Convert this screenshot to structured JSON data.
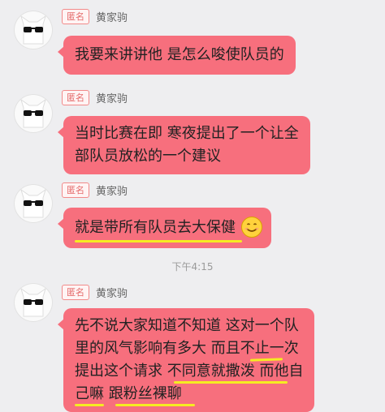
{
  "messages": [
    {
      "badge": "匿名",
      "sender": "黄家驹",
      "lines": [
        "我要来讲讲他 是怎么唆使队员的"
      ]
    },
    {
      "badge": "匿名",
      "sender": "黄家驹",
      "lines": [
        "当时比赛在即 寒夜提出了一个让全",
        "部队员放松的一个建议"
      ]
    },
    {
      "badge": "匿名",
      "sender": "黄家驹",
      "lines": [
        "就是带所有队员去大保健"
      ]
    },
    {
      "badge": "匿名",
      "sender": "黄家驹",
      "lines": [
        "先不说大家知道不知道 这对一个队",
        "里的风气影响有多大 而且不止一次",
        "提出这个请求 不同意就撒泼 而他自",
        "己嘛 跟粉丝裸聊"
      ]
    }
  ],
  "timestamp": "下午4:15",
  "colors": {
    "bubble": "#f76f7d",
    "highlight": "#f5ec22",
    "background": "#eeeef0"
  },
  "icons": {
    "avatar": "cat-with-sunglasses-icon",
    "emoji": "smiling-face-icon"
  }
}
